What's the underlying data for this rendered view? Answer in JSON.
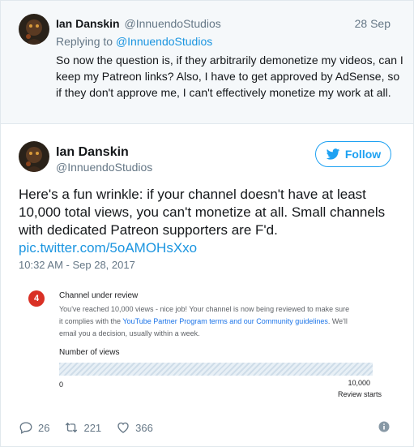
{
  "reply_tweet": {
    "author_name": "Ian Danskin",
    "author_handle": "@InnuendoStudios",
    "date": "28 Sep",
    "replying_prefix": "Replying to",
    "replying_to": "@InnuendoStudios",
    "text": "So now the question is, if they arbitrarily demonetize my videos, can I keep my Patreon links? Also, I have to get approved by AdSense, so if they don't approve me, I can't effectively monetize my work at all."
  },
  "main_tweet": {
    "author_name": "Ian Danskin",
    "author_handle": "@InnuendoStudios",
    "follow_label": "Follow",
    "text": "Here's a fun wrinkle: if your channel doesn't have at least 10,000 total views, you can't monetize at all. Small channels with dedicated Patreon supporters are F'd.",
    "pic_link": "pic.twitter.com/5oAMOHsXxo",
    "timestamp": "10:32 AM - Sep 28, 2017"
  },
  "media": {
    "step_number": "4",
    "title": "Channel under review",
    "body_text": "You've reached 10,000 views - nice job! Your channel is now being reviewed to make sure it complies with the",
    "link_text": "YouTube Partner Program terms and our Community guidelines",
    "body_end": ". We'll email you a decision, usually within a week.",
    "progress_label": "Number of views",
    "progress_fraction": 1.0,
    "axis_min": "0",
    "axis_max": "10,000",
    "axis_max_caption": "Review starts"
  },
  "actions": {
    "replies": "26",
    "retweets": "221",
    "likes": "366"
  },
  "colors": {
    "twitter_blue": "#1da1f2",
    "link_blue": "#1b95e0",
    "muted": "#657786",
    "badge_red": "#d93025"
  }
}
